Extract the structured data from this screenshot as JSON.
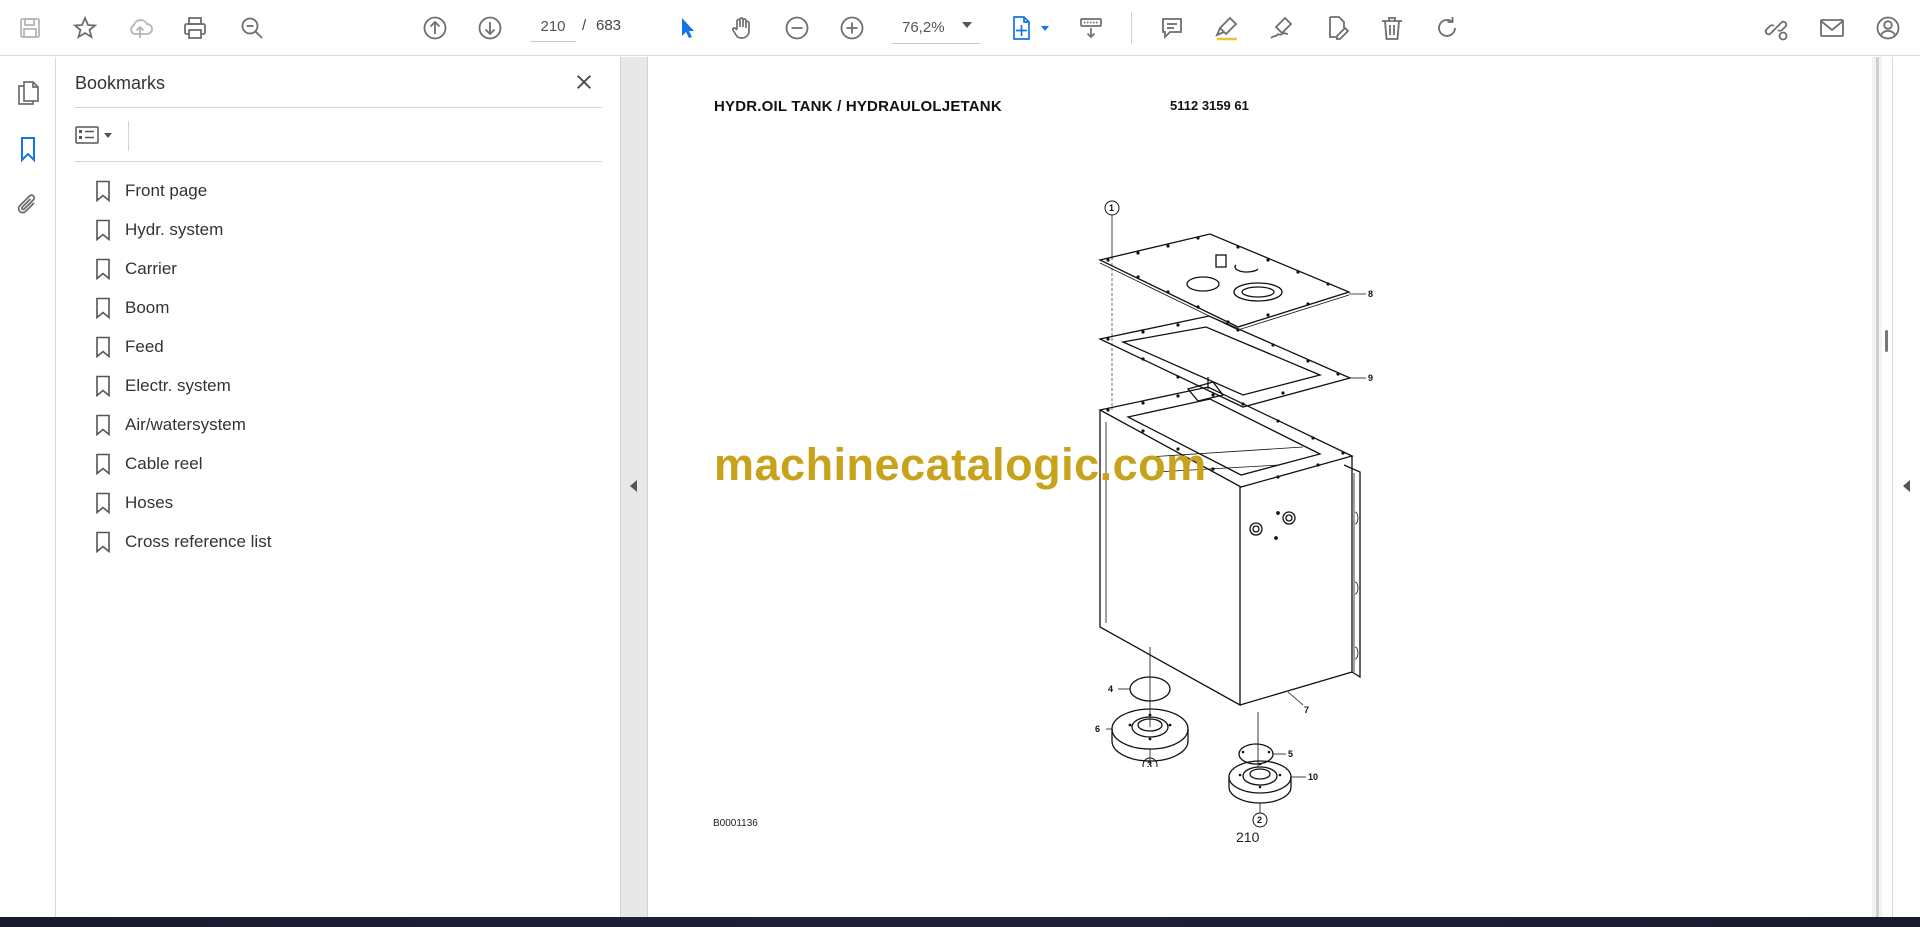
{
  "toolbar": {
    "current_page": "210",
    "page_separator": "/",
    "total_pages": "683",
    "zoom": "76,2%",
    "icons": [
      "save-icon",
      "star-icon",
      "cloud-upload-icon",
      "print-icon",
      "zoom-search-icon",
      "arrow-up-icon",
      "arrow-down-icon",
      "select-pointer-icon",
      "hand-icon",
      "zoom-out-icon",
      "zoom-in-icon",
      "fit-page-icon",
      "scroll-mode-icon",
      "comment-icon",
      "highlight-pen-icon",
      "sign-icon",
      "edit-pdf-icon",
      "delete-icon",
      "rotate-icon",
      "share-link-icon",
      "email-icon",
      "user-icon"
    ]
  },
  "rail": {
    "icons": [
      "pages-icon",
      "bookmark-icon",
      "attachment-icon"
    ]
  },
  "bookmarks": {
    "title": "Bookmarks",
    "items": [
      {
        "label": "Front page"
      },
      {
        "label": "Hydr. system"
      },
      {
        "label": "Carrier"
      },
      {
        "label": "Boom"
      },
      {
        "label": "Feed"
      },
      {
        "label": "Electr. system"
      },
      {
        "label": "Air/watersystem"
      },
      {
        "label": "Cable reel"
      },
      {
        "label": "Hoses"
      },
      {
        "label": "Cross reference list"
      }
    ]
  },
  "document": {
    "title": "HYDR.OIL TANK / HYDRAULOLJETANK",
    "part_number": "5112 3159 61",
    "drawing_code": "B0001136",
    "page_number": "210",
    "watermark": "machinecatalogic.com",
    "callouts": {
      "c1": "1",
      "c2": "2",
      "c3": "3",
      "c4": "4",
      "c5": "5",
      "c6": "6",
      "c7": "7",
      "c8": "8",
      "c9": "9",
      "c10": "10"
    }
  },
  "colors": {
    "accent": "#1473e6",
    "watermark": "#c9a21b",
    "icon": "#6e6e6e"
  }
}
